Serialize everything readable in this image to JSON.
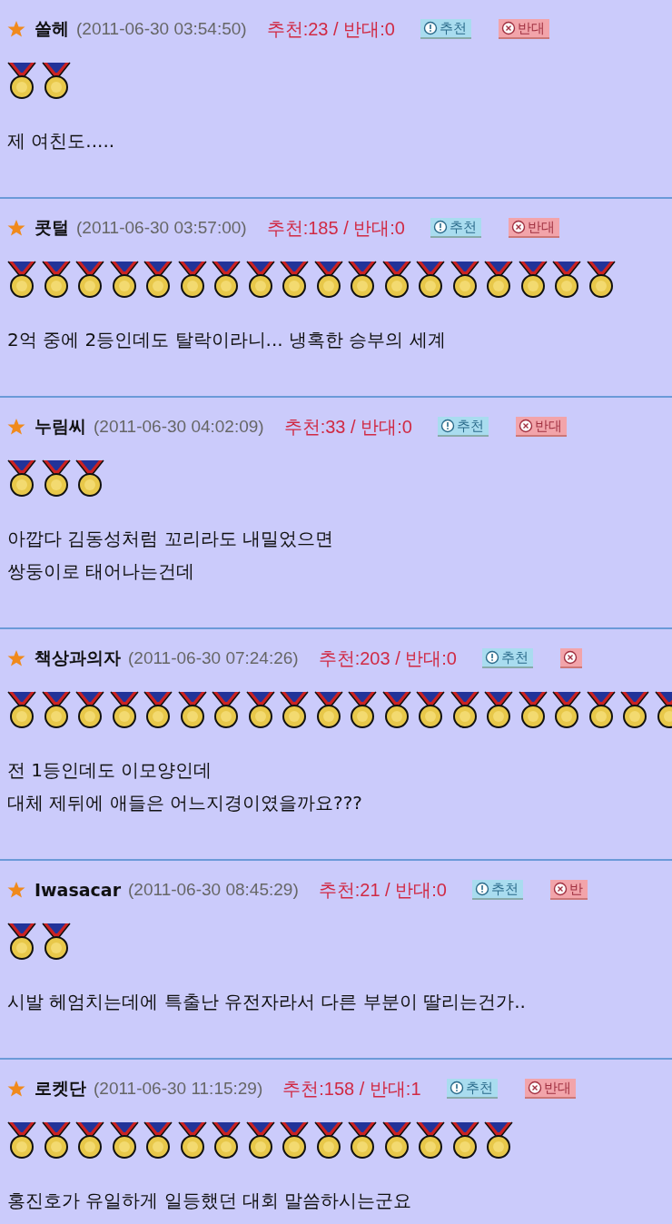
{
  "comments": [
    {
      "author": "쏠헤",
      "date": "(2011-06-30 03:54:50)",
      "votes": "추천:23 / 반대:0",
      "recommend_label": "추천",
      "oppose_label": "반대",
      "medals": [
        {
          "kind": "medal"
        },
        {
          "kind": "medal"
        }
      ],
      "text": "제 여친도....."
    },
    {
      "author": "콧털",
      "date": "(2011-06-30 03:57:00)",
      "votes": "추천:185 / 반대:0",
      "recommend_label": "추천",
      "oppose_label": "반대",
      "medals": [
        {
          "kind": "medal"
        },
        {
          "kind": "medal"
        },
        {
          "kind": "medal"
        },
        {
          "kind": "medal"
        },
        {
          "kind": "medal"
        },
        {
          "kind": "medal"
        },
        {
          "kind": "medal"
        },
        {
          "kind": "medal"
        },
        {
          "kind": "medal"
        },
        {
          "kind": "medal"
        },
        {
          "kind": "medal"
        },
        {
          "kind": "medal"
        },
        {
          "kind": "medal"
        },
        {
          "kind": "medal"
        },
        {
          "kind": "medal"
        },
        {
          "kind": "medal"
        },
        {
          "kind": "medal"
        },
        {
          "kind": "medal"
        }
      ],
      "text": "2억 중에 2등인데도 탈락이라니... 냉혹한 승부의 세계"
    },
    {
      "author": "누림씨",
      "date": "(2011-06-30 04:02:09)",
      "votes": "추천:33 / 반대:0",
      "recommend_label": "추천",
      "oppose_label": "반대",
      "medals": [
        {
          "kind": "medal"
        },
        {
          "kind": "medal"
        },
        {
          "kind": "medal"
        }
      ],
      "text": "아깝다 김동성처럼 꼬리라도 내밀었으면\n쌍둥이로 태어나는건데"
    },
    {
      "author": "책상과의자",
      "date": "(2011-06-30 07:24:26)",
      "votes": "추천:203 / 반대:0",
      "recommend_label": "추천",
      "medals": [
        {
          "kind": "medal"
        },
        {
          "kind": "medal"
        },
        {
          "kind": "medal"
        },
        {
          "kind": "medal"
        },
        {
          "kind": "medal"
        },
        {
          "kind": "medal"
        },
        {
          "kind": "medal"
        },
        {
          "kind": "medal"
        },
        {
          "kind": "medal"
        },
        {
          "kind": "medal"
        },
        {
          "kind": "medal"
        },
        {
          "kind": "medal"
        },
        {
          "kind": "medal"
        },
        {
          "kind": "medal"
        },
        {
          "kind": "medal"
        },
        {
          "kind": "medal"
        },
        {
          "kind": "medal"
        },
        {
          "kind": "medal"
        },
        {
          "kind": "medal"
        },
        {
          "kind": "medal"
        }
      ],
      "text": "전 1등인데도 이모양인데\n대체 제뒤에 애들은 어느지경이였을까요???"
    },
    {
      "author": "Iwasacar",
      "date": "(2011-06-30 08:45:29)",
      "votes": "추천:21 / 반대:0",
      "recommend_label": "추천",
      "oppose_label": "반",
      "medals": [
        {
          "kind": "medal"
        },
        {
          "kind": "medal"
        }
      ],
      "text": "시발 헤엄치는데에 특출난 유전자라서 다른 부분이 딸리는건가.."
    },
    {
      "author": "로켓단",
      "date": "(2011-06-30 11:15:29)",
      "votes": "추천:158 / 반대:1",
      "recommend_label": "추천",
      "oppose_label": "반대",
      "medals": [
        {
          "kind": "medal"
        },
        {
          "kind": "medal"
        },
        {
          "kind": "medal"
        },
        {
          "kind": "medal"
        },
        {
          "kind": "medal"
        },
        {
          "kind": "medal"
        },
        {
          "kind": "medal"
        },
        {
          "kind": "medal"
        },
        {
          "kind": "medal"
        },
        {
          "kind": "medal"
        },
        {
          "kind": "medal"
        },
        {
          "kind": "medal"
        },
        {
          "kind": "medal"
        },
        {
          "kind": "medal"
        },
        {
          "kind": "medal"
        }
      ],
      "text": "홍진호가 유일하게 일등했던 대회 말씀하시는군요"
    }
  ]
}
